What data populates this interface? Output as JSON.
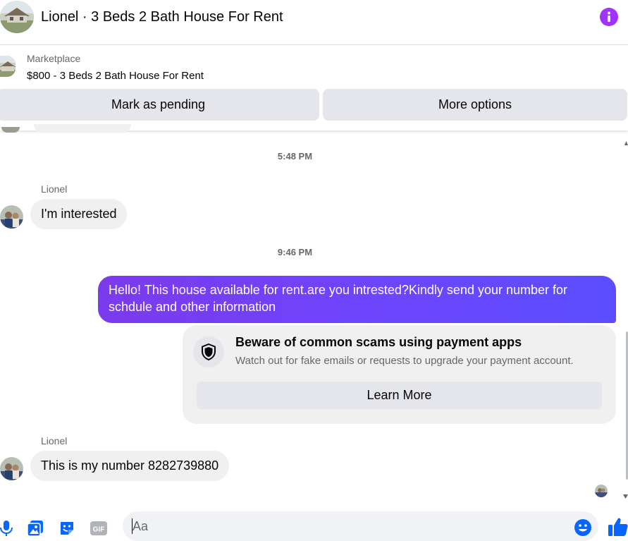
{
  "header": {
    "title": "Lionel · 3 Beds 2 Bath House For Rent"
  },
  "listing": {
    "source": "Marketplace",
    "price_title": "$800 - 3 Beds 2 Bath House For Rent",
    "mark_pending_label": "Mark as pending",
    "more_options_label": "More options"
  },
  "messages": {
    "timestamp_1": "5:48 PM",
    "timestamp_2": "9:46 PM",
    "incoming_1": {
      "sender": "Lionel",
      "text": "I'm interested"
    },
    "outgoing_1": {
      "text": "Hello! This house available for rent.are you intrested?Kindly send your number for schdule and other information"
    },
    "scam_warning": {
      "title": "Beware of common scams using payment apps",
      "subtitle": "Watch out for fake emails or requests to upgrade your payment account.",
      "button_label": "Learn More"
    },
    "incoming_2": {
      "sender": "Lionel",
      "text": "This is my number 8282739880"
    }
  },
  "composer": {
    "placeholder": "Aa"
  },
  "colors": {
    "accent": "#0866ff",
    "info_purple": "#a033ff",
    "outgoing_bubble": "#6b46ff"
  },
  "icons": {
    "info": "info-icon",
    "shield": "shield-icon",
    "mic": "microphone-icon",
    "photo": "photo-icon",
    "sticker": "sticker-icon",
    "gif": "gif-icon",
    "emoji": "emoji-icon",
    "like": "thumbs-up-icon"
  }
}
